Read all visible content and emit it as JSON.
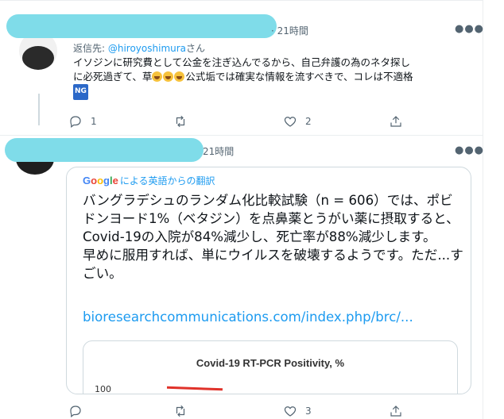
{
  "tweet1": {
    "time": "· 21時間",
    "reply_prefix": "返信先: ",
    "reply_mention": "@hiroyoshimura",
    "reply_suffix": "さん",
    "text_part1": "イソジンに研究費として公金を注ぎ込んでるから、自己弁護の為のネタ探しに必死過ぎて、草",
    "text_part2": "公式垢では確実な情報を流すべきで、コレは不適格",
    "ng_badge": "NG",
    "reply_count": "",
    "retweet_count": "",
    "like_count": "2",
    "reply_icon_count": "1"
  },
  "tweet2": {
    "time": "21時間",
    "translate_google": "Google",
    "translate_label": "による英語からの翻訳",
    "translated_text": "バングラデシュのランダム化比較試験（n = 606）では、ポビドンヨード1%（ベタジン）を点鼻薬とうがい薬に摂取すると、Covid-19の入院が84%減少し、死亡率が88%減少します。\n早めに服用すれば、単にウイルスを破壊するようです。ただ...すごい。",
    "link": "bioresearchcommunications.com/index.php/brc/...",
    "embed_title": "Covid-19 RT-PCR Positivity, %",
    "embed_axis_label": "100",
    "like_count": "3"
  },
  "colors": {
    "accent": "#1d9bf0",
    "muted": "#536471",
    "redaction": "#7fdce9",
    "chart_line": "#e0322a"
  },
  "google_colors": [
    "#4285f4",
    "#ea4335",
    "#fbbc05",
    "#4285f4",
    "#34a853",
    "#ea4335"
  ]
}
